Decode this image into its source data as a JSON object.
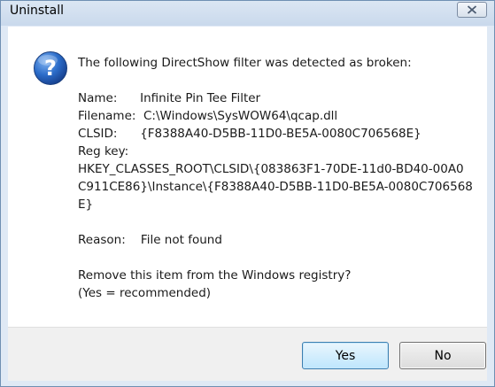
{
  "window": {
    "title": "Uninstall"
  },
  "message": {
    "heading": "The following DirectShow filter was detected as broken:",
    "name_line": "Name:      Infinite Pin Tee Filter",
    "filename_line": "Filename:  C:\\Windows\\SysWOW64\\qcap.dll",
    "clsid_line": "CLSID:      {F8388A40-D5BB-11D0-BE5A-0080C706568E}",
    "regkey_label": "Reg key:",
    "regkey_line1": "HKEY_CLASSES_ROOT\\CLSID\\{083863F1-70DE-11d0-BD40-00A0",
    "regkey_line2": "C911CE86}\\Instance\\{F8388A40-D5BB-11D0-BE5A-0080C706568",
    "regkey_line3": "E}",
    "reason_line": "Reason:    File not found",
    "question_line1": "Remove this item from the Windows registry?",
    "question_line2": "(Yes = recommended)"
  },
  "buttons": {
    "yes_label": "Yes",
    "no_label": "No"
  },
  "icons": {
    "dialog_icon": "question-icon",
    "close_icon": "close-icon"
  }
}
